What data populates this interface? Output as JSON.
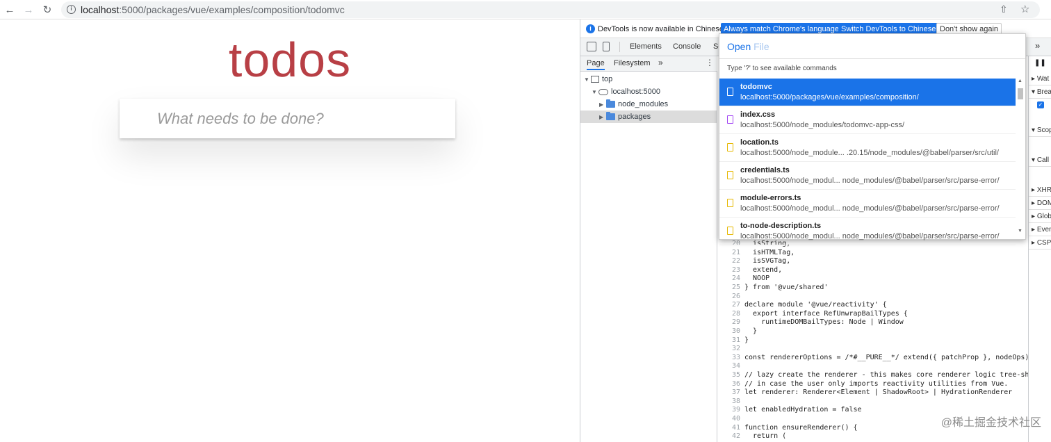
{
  "browser": {
    "url_host": "localhost",
    "url_rest": ":5000/packages/vue/examples/composition/todomvc"
  },
  "todo": {
    "title": "todos",
    "placeholder": "What needs to be done?"
  },
  "devtools": {
    "info_text": "DevTools is now available in Chinese!",
    "btn_match": "Always match Chrome's language",
    "btn_switch": "Switch DevTools to Chinese",
    "btn_dismiss": "Don't show again",
    "tabs": [
      "Elements",
      "Console",
      "So"
    ],
    "more": "»",
    "nav_tabs": [
      "Page",
      "Filesystem",
      "»"
    ],
    "tree": [
      "top",
      "localhost:5000",
      "node_modules",
      "packages"
    ],
    "command": {
      "prompt": "Open",
      "placeholder": "File",
      "hint": "Type '?' to see available commands",
      "items": [
        {
          "name": "todomvc",
          "path": "localhost:5000/packages/vue/examples/composition/"
        },
        {
          "name": "index.css",
          "path": "localhost:5000/node_modules/todomvc-app-css/"
        },
        {
          "name": "location.ts",
          "path": "localhost:5000/node_module... .20.15/node_modules/@babel/parser/src/util/"
        },
        {
          "name": "credentials.ts",
          "path": "localhost:5000/node_modul... node_modules/@babel/parser/src/parse-error/"
        },
        {
          "name": "module-errors.ts",
          "path": "localhost:5000/node_modul... node_modules/@babel/parser/src/parse-error/"
        },
        {
          "name": "to-node-description.ts",
          "path": "localhost:5000/node_modul... node_modules/@babel/parser/src/parse-error/"
        }
      ]
    },
    "right_panes": [
      "Wat",
      "Brea",
      "Scop",
      "Call",
      "XHR",
      "DOM",
      "Glob",
      "Even",
      "CSP"
    ],
    "code_lines": [
      {
        "n": "20",
        "t": "  isString,"
      },
      {
        "n": "21",
        "t": "  isHTMLTag,"
      },
      {
        "n": "22",
        "t": "  isSVGTag,"
      },
      {
        "n": "23",
        "t": "  extend,"
      },
      {
        "n": "24",
        "t": "  NOOP"
      },
      {
        "n": "25",
        "t": "} from '@vue/shared'"
      },
      {
        "n": "26",
        "t": ""
      },
      {
        "n": "27",
        "t": "declare module '@vue/reactivity' {"
      },
      {
        "n": "28",
        "t": "  export interface RefUnwrapBailTypes {"
      },
      {
        "n": "29",
        "t": "    runtimeDOMBailTypes: Node | Window"
      },
      {
        "n": "30",
        "t": "  }"
      },
      {
        "n": "31",
        "t": "}"
      },
      {
        "n": "32",
        "t": ""
      },
      {
        "n": "33",
        "t": "const rendererOptions = /*#__PURE__*/ extend({ patchProp }, nodeOps)"
      },
      {
        "n": "34",
        "t": ""
      },
      {
        "n": "35",
        "t": "// lazy create the renderer - this makes core renderer logic tree-sh"
      },
      {
        "n": "36",
        "t": "// in case the user only imports reactivity utilities from Vue."
      },
      {
        "n": "37",
        "t": "let renderer: Renderer<Element | ShadowRoot> | HydrationRenderer"
      },
      {
        "n": "38",
        "t": ""
      },
      {
        "n": "39",
        "t": "let enabledHydration = false"
      },
      {
        "n": "40",
        "t": ""
      },
      {
        "n": "41",
        "t": "function ensureRenderer() {"
      },
      {
        "n": "42",
        "t": "  return ("
      }
    ]
  },
  "watermark": "@稀土掘金技术社区"
}
